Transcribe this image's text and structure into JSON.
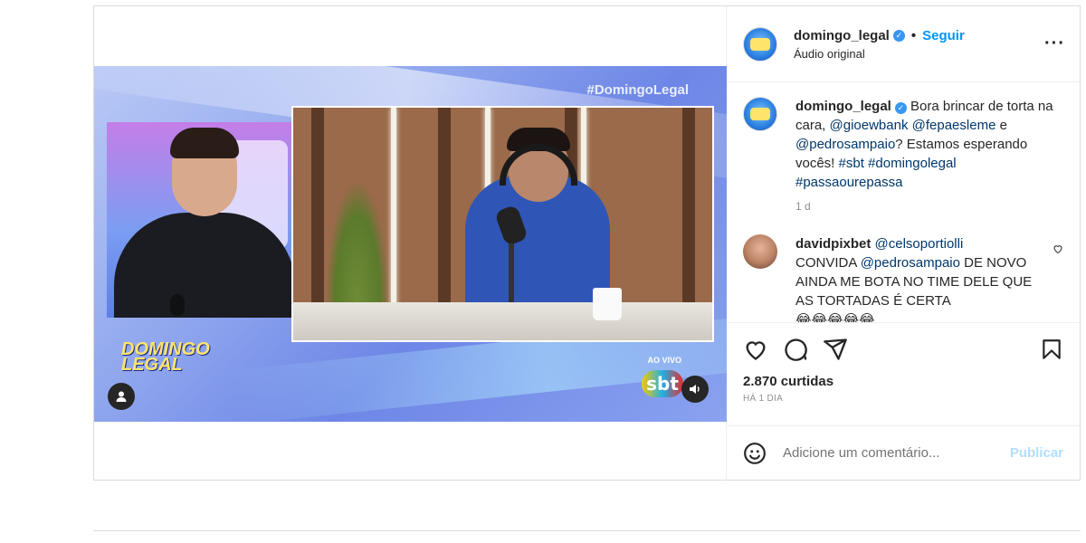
{
  "post": {
    "video": {
      "hashtag_overlay": "#DomingoLegal",
      "logo_text": "DOMINGO LEGAL",
      "live_label": "AO VIVO",
      "channel_logo": "sbt"
    },
    "header": {
      "username": "domingo_legal",
      "separator": "•",
      "follow_label": "Seguir",
      "audio_label": "Áudio original",
      "more_label": "···"
    },
    "caption": {
      "username": "domingo_legal",
      "text_1": " Bora brincar de torta na cara, ",
      "mention_1": "@gioewbank",
      "mention_2": "@fepaesleme",
      "text_2": " e ",
      "mention_3": "@pedrosampaio",
      "text_3": "? Estamos esperando vocês! ",
      "tag_1": "#sbt",
      "tag_2": "#domingolegal",
      "tag_3": "#passaourepassa",
      "time": "1 d"
    },
    "comment": {
      "username": "davidpixbet",
      "mention_1": "@celsoportiolli",
      "text_1": "CONVIDA ",
      "mention_2": "@pedrosampaio",
      "text_2": " DE NOVO AINDA ME BOTA NO TIME DELE QUE AS TORTADAS É CERTA",
      "emojis": "😂😂😂😂😂"
    },
    "actions": {
      "likes": "2.870 curtidas",
      "date": "HÁ 1 DIA"
    },
    "add_comment": {
      "placeholder": "Adicione um comentário...",
      "publish_label": "Publicar"
    }
  },
  "colors": {
    "link_blue": "#0095f6",
    "mention_blue": "#00376b",
    "verified": "#3897f0",
    "publish_disabled": "#b2dffc"
  },
  "icons": [
    "user-tag-icon",
    "volume-icon",
    "verified-badge-icon",
    "more-icon",
    "heart-icon",
    "comment-icon",
    "share-icon",
    "save-icon",
    "emoji-icon"
  ]
}
